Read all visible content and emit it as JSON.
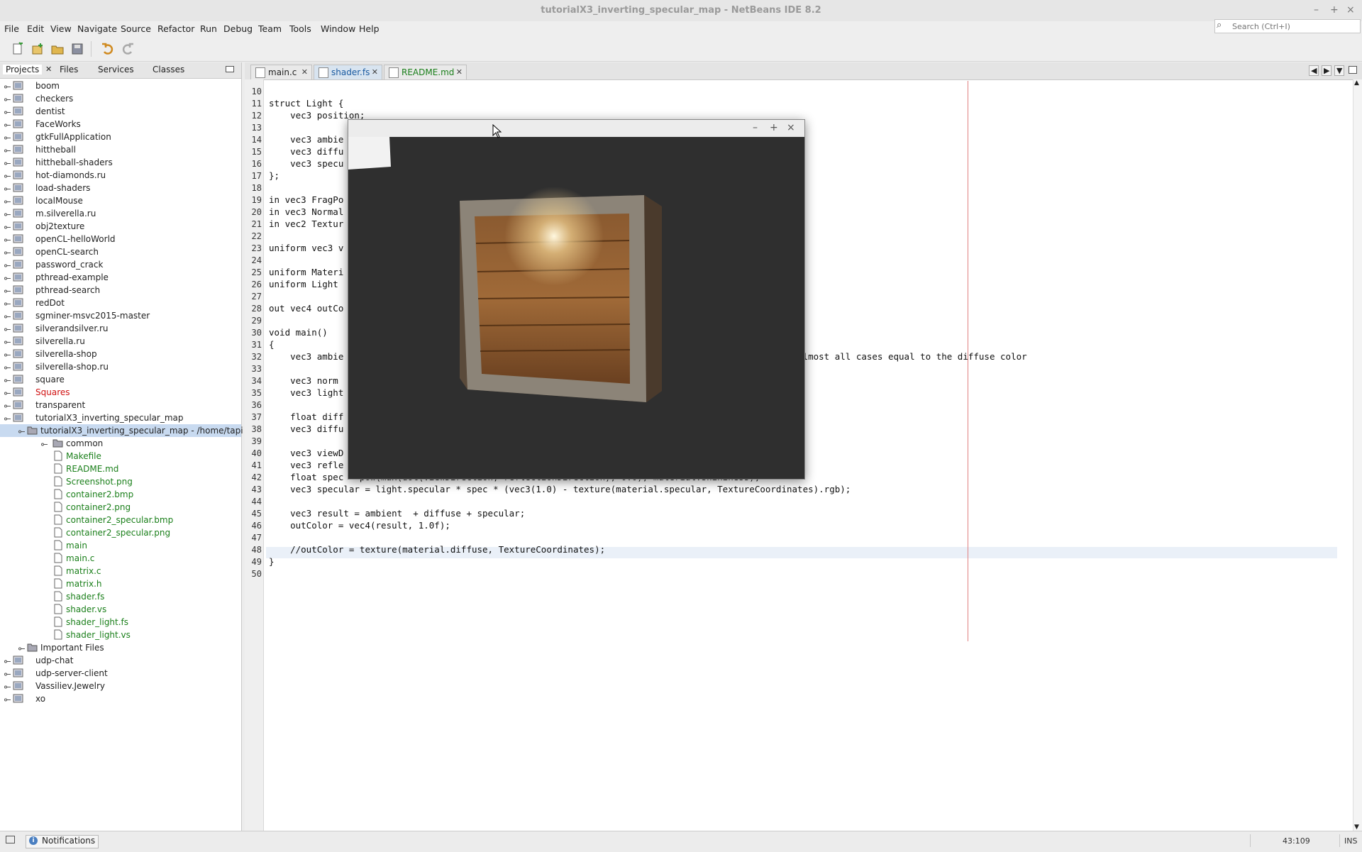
{
  "window": {
    "title": "tutorialX3_inverting_specular_map - NetBeans IDE 8.2"
  },
  "menu": [
    "File",
    "Edit",
    "View",
    "Navigate",
    "Source",
    "Refactor",
    "Run",
    "Debug",
    "Team",
    "Tools",
    "Window",
    "Help"
  ],
  "search": {
    "placeholder": "Search (Ctrl+I)"
  },
  "panel_tabs": [
    "Projects",
    "Files",
    "Services",
    "Classes"
  ],
  "projects": [
    {
      "label": "boom",
      "level": 0,
      "kind": "project"
    },
    {
      "label": "checkers",
      "level": 0,
      "kind": "project"
    },
    {
      "label": "dentist",
      "level": 0,
      "kind": "project"
    },
    {
      "label": "FaceWorks",
      "level": 0,
      "kind": "project"
    },
    {
      "label": "gtkFullApplication",
      "level": 0,
      "kind": "project"
    },
    {
      "label": "hittheball",
      "level": 0,
      "kind": "project"
    },
    {
      "label": "hittheball-shaders",
      "level": 0,
      "kind": "project"
    },
    {
      "label": "hot-diamonds.ru",
      "level": 0,
      "kind": "project"
    },
    {
      "label": "load-shaders",
      "level": 0,
      "kind": "project"
    },
    {
      "label": "localMouse",
      "level": 0,
      "kind": "project"
    },
    {
      "label": "m.silverella.ru",
      "level": 0,
      "kind": "project"
    },
    {
      "label": "obj2texture",
      "level": 0,
      "kind": "project"
    },
    {
      "label": "openCL-helloWorld",
      "level": 0,
      "kind": "project"
    },
    {
      "label": "openCL-search",
      "level": 0,
      "kind": "project"
    },
    {
      "label": "password_crack",
      "level": 0,
      "kind": "project"
    },
    {
      "label": "pthread-example",
      "level": 0,
      "kind": "project"
    },
    {
      "label": "pthread-search",
      "level": 0,
      "kind": "project"
    },
    {
      "label": "redDot",
      "level": 0,
      "kind": "project"
    },
    {
      "label": "sgminer-msvc2015-master",
      "level": 0,
      "kind": "project"
    },
    {
      "label": "silverandsilver.ru",
      "level": 0,
      "kind": "project"
    },
    {
      "label": "silverella.ru",
      "level": 0,
      "kind": "project"
    },
    {
      "label": "silverella-shop",
      "level": 0,
      "kind": "project"
    },
    {
      "label": "silverella-shop.ru",
      "level": 0,
      "kind": "project"
    },
    {
      "label": "square",
      "level": 0,
      "kind": "project"
    },
    {
      "label": "Squares",
      "level": 0,
      "kind": "project",
      "color": "#d01010"
    },
    {
      "label": "transparent",
      "level": 0,
      "kind": "project"
    },
    {
      "label": "tutorialX3_inverting_specular_map",
      "level": 0,
      "kind": "project",
      "expanded": true
    },
    {
      "label": "tutorialX3_inverting_specular_map - /home/tapi",
      "level": 1,
      "kind": "folder",
      "selected": true,
      "expanded": true
    },
    {
      "label": "common",
      "level": 2,
      "kind": "folder"
    },
    {
      "label": "Makefile",
      "level": 2,
      "kind": "file",
      "color": "#1a7f1a"
    },
    {
      "label": "README.md",
      "level": 2,
      "kind": "file",
      "color": "#1a7f1a"
    },
    {
      "label": "Screenshot.png",
      "level": 2,
      "kind": "file",
      "color": "#1a7f1a"
    },
    {
      "label": "container2.bmp",
      "level": 2,
      "kind": "file",
      "color": "#1a7f1a"
    },
    {
      "label": "container2.png",
      "level": 2,
      "kind": "file",
      "color": "#1a7f1a"
    },
    {
      "label": "container2_specular.bmp",
      "level": 2,
      "kind": "file",
      "color": "#1a7f1a"
    },
    {
      "label": "container2_specular.png",
      "level": 2,
      "kind": "file",
      "color": "#1a7f1a"
    },
    {
      "label": "main",
      "level": 2,
      "kind": "file",
      "color": "#1a7f1a"
    },
    {
      "label": "main.c",
      "level": 2,
      "kind": "file",
      "color": "#1a7f1a"
    },
    {
      "label": "matrix.c",
      "level": 2,
      "kind": "file",
      "color": "#1a7f1a"
    },
    {
      "label": "matrix.h",
      "level": 2,
      "kind": "file",
      "color": "#1a7f1a"
    },
    {
      "label": "shader.fs",
      "level": 2,
      "kind": "file",
      "color": "#1a7f1a"
    },
    {
      "label": "shader.vs",
      "level": 2,
      "kind": "file",
      "color": "#1a7f1a"
    },
    {
      "label": "shader_light.fs",
      "level": 2,
      "kind": "file",
      "color": "#1a7f1a"
    },
    {
      "label": "shader_light.vs",
      "level": 2,
      "kind": "file",
      "color": "#1a7f1a"
    },
    {
      "label": "Important Files",
      "level": 1,
      "kind": "folder"
    },
    {
      "label": "udp-chat",
      "level": 0,
      "kind": "project"
    },
    {
      "label": "udp-server-client",
      "level": 0,
      "kind": "project"
    },
    {
      "label": "Vassiliev.Jewelry",
      "level": 0,
      "kind": "project"
    },
    {
      "label": "xo",
      "level": 0,
      "kind": "project"
    }
  ],
  "editor_tabs": [
    {
      "label": "main.c",
      "active": false
    },
    {
      "label": "shader.fs",
      "active": true
    },
    {
      "label": "README.md",
      "active": false
    }
  ],
  "code": [
    {
      "n": 10,
      "text": ""
    },
    {
      "n": 11,
      "text": "struct Light {"
    },
    {
      "n": 12,
      "text": "    vec3 position;"
    },
    {
      "n": 13,
      "text": ""
    },
    {
      "n": 14,
      "text": "    vec3 ambie"
    },
    {
      "n": 15,
      "text": "    vec3 diffu"
    },
    {
      "n": 16,
      "text": "    vec3 specu"
    },
    {
      "n": 17,
      "text": "};"
    },
    {
      "n": 18,
      "text": ""
    },
    {
      "n": 19,
      "text": "in vec3 FragPo"
    },
    {
      "n": 20,
      "text": "in vec3 Normal"
    },
    {
      "n": 21,
      "text": "in vec2 Textur"
    },
    {
      "n": 22,
      "text": ""
    },
    {
      "n": 23,
      "text": "uniform vec3 v"
    },
    {
      "n": 24,
      "text": ""
    },
    {
      "n": 25,
      "text": "uniform Materi"
    },
    {
      "n": 26,
      "text": "uniform Light"
    },
    {
      "n": 27,
      "text": ""
    },
    {
      "n": 28,
      "text": "out vec4 outCo"
    },
    {
      "n": 29,
      "text": ""
    },
    {
      "n": 30,
      "text": "void main()"
    },
    {
      "n": 31,
      "text": "{"
    },
    {
      "n": 32,
      "text": "    vec3 ambie                                                                      nt color is in almost all cases equal to the diffuse color"
    },
    {
      "n": 33,
      "text": ""
    },
    {
      "n": 34,
      "text": "    vec3 norm"
    },
    {
      "n": 35,
      "text": "    vec3 light"
    },
    {
      "n": 36,
      "text": ""
    },
    {
      "n": 37,
      "text": "    float diff"
    },
    {
      "n": 38,
      "text": "    vec3 diffu"
    },
    {
      "n": 39,
      "text": ""
    },
    {
      "n": 40,
      "text": "    vec3 viewD"
    },
    {
      "n": 41,
      "text": "    vec3 refle"
    },
    {
      "n": 42,
      "text": "    float spec = pow(max(dot(viewDirection, reflectionDirection), 0.0), material.shininess);"
    },
    {
      "n": 43,
      "text": "    vec3 specular = light.specular * spec * (vec3(1.0) - texture(material.specular, TextureCoordinates).rgb);"
    },
    {
      "n": 44,
      "text": ""
    },
    {
      "n": 45,
      "text": "    vec3 result = ambient  + diffuse + specular;"
    },
    {
      "n": 46,
      "text": "    outColor = vec4(result, 1.0f);"
    },
    {
      "n": 47,
      "text": ""
    },
    {
      "n": 48,
      "text": "    //outColor = texture(material.diffuse, TextureCoordinates);"
    },
    {
      "n": 49,
      "text": "}"
    },
    {
      "n": 50,
      "text": ""
    }
  ],
  "status": {
    "notifications": "Notifications",
    "position": "43:109",
    "mode": "INS"
  },
  "colors": {
    "accent": "#4a7fc1",
    "error_red": "#d01010",
    "file_green": "#1a7f1a"
  }
}
